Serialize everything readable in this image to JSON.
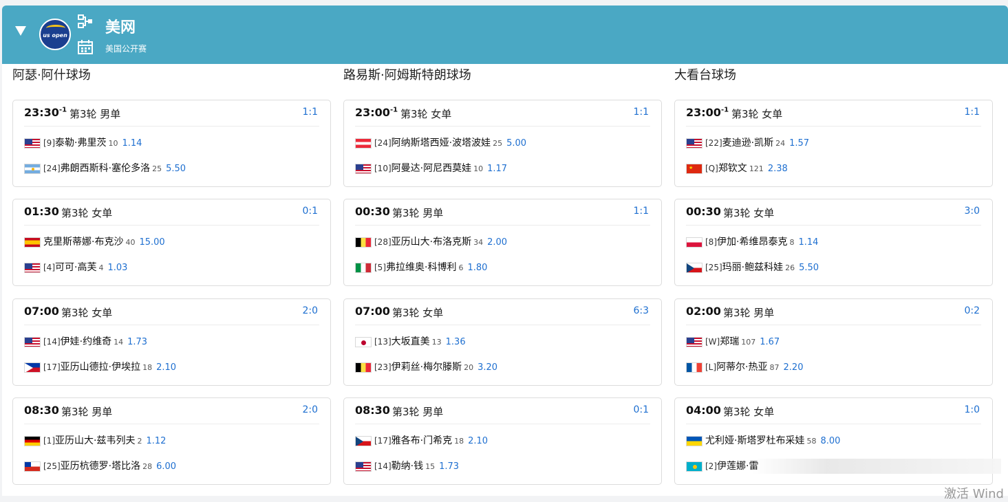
{
  "header": {
    "title": "美网",
    "subtitle": "美国公开赛",
    "logo_text": "us open"
  },
  "courts": [
    {
      "name": "阿瑟·阿什球场",
      "matches": [
        {
          "time": "23:30",
          "time_sup": "-1",
          "round": "第3轮 男单",
          "score": "1:1",
          "p1": {
            "flag": "us",
            "seed": "[9]",
            "name": "泰勒·弗里茨",
            "rank": "10",
            "odds": "1.14"
          },
          "p2": {
            "flag": "ar",
            "seed": "[24]",
            "name": "弗朗西斯科·塞伦多洛",
            "rank": "25",
            "odds": "5.50"
          }
        },
        {
          "time": "01:30",
          "time_sup": "",
          "round": "第3轮 女单",
          "score": "0:1",
          "p1": {
            "flag": "es",
            "seed": "",
            "name": "克里斯蒂娜·布克沙",
            "rank": "40",
            "odds": "15.00"
          },
          "p2": {
            "flag": "us",
            "seed": "[4]",
            "name": "可可·高芙",
            "rank": "4",
            "odds": "1.03"
          }
        },
        {
          "time": "07:00",
          "time_sup": "",
          "round": "第3轮 女单",
          "score": "2:0",
          "p1": {
            "flag": "us",
            "seed": "[14]",
            "name": "伊娃·约维奇",
            "rank": "14",
            "odds": "1.73"
          },
          "p2": {
            "flag": "ph",
            "seed": "[17]",
            "name": "亚历山德拉·伊埃拉",
            "rank": "18",
            "odds": "2.10"
          }
        },
        {
          "time": "08:30",
          "time_sup": "",
          "round": "第3轮 男单",
          "score": "2:0",
          "p1": {
            "flag": "de",
            "seed": "[1]",
            "name": "亚历山大·兹韦列夫",
            "rank": "2",
            "odds": "1.12"
          },
          "p2": {
            "flag": "cl",
            "seed": "[25]",
            "name": "亚历杭德罗·塔比洛",
            "rank": "28",
            "odds": "6.00"
          }
        }
      ]
    },
    {
      "name": "路易斯·阿姆斯特朗球场",
      "matches": [
        {
          "time": "23:00",
          "time_sup": "-1",
          "round": "第3轮 女单",
          "score": "1:1",
          "p1": {
            "flag": "at",
            "seed": "[24]",
            "name": "阿纳斯塔西娅·波塔波娃",
            "rank": "25",
            "odds": "5.00"
          },
          "p2": {
            "flag": "us",
            "seed": "[10]",
            "name": "阿曼达·阿尼西莫娃",
            "rank": "10",
            "odds": "1.17"
          }
        },
        {
          "time": "00:30",
          "time_sup": "",
          "round": "第3轮 男单",
          "score": "1:1",
          "p1": {
            "flag": "be",
            "seed": "[28]",
            "name": "亚历山大·布洛克斯",
            "rank": "34",
            "odds": "2.00"
          },
          "p2": {
            "flag": "it",
            "seed": "[5]",
            "name": "弗拉维奥·科博利",
            "rank": "6",
            "odds": "1.80"
          }
        },
        {
          "time": "07:00",
          "time_sup": "",
          "round": "第3轮 女单",
          "score": "6:3",
          "p1": {
            "flag": "jp",
            "seed": "[13]",
            "name": "大坂直美",
            "rank": "13",
            "odds": "1.36"
          },
          "p2": {
            "flag": "be",
            "seed": "[23]",
            "name": "伊莉丝·梅尔滕斯",
            "rank": "20",
            "odds": "3.20"
          }
        },
        {
          "time": "08:30",
          "time_sup": "",
          "round": "第3轮 男单",
          "score": "0:1",
          "p1": {
            "flag": "cz",
            "seed": "[17]",
            "name": "雅各布·门希克",
            "rank": "18",
            "odds": "2.10"
          },
          "p2": {
            "flag": "us",
            "seed": "[14]",
            "name": "勒纳·钱",
            "rank": "15",
            "odds": "1.73"
          }
        }
      ]
    },
    {
      "name": "大看台球场",
      "matches": [
        {
          "time": "23:00",
          "time_sup": "-1",
          "round": "第3轮 女单",
          "score": "1:1",
          "p1": {
            "flag": "us",
            "seed": "[22]",
            "name": "麦迪逊·凯斯",
            "rank": "24",
            "odds": "1.57"
          },
          "p2": {
            "flag": "cn",
            "seed": "[Q]",
            "name": "郑钦文",
            "rank": "121",
            "odds": "2.38"
          }
        },
        {
          "time": "00:30",
          "time_sup": "",
          "round": "第3轮 女单",
          "score": "3:0",
          "p1": {
            "flag": "pl",
            "seed": "[8]",
            "name": "伊加·希维昂泰克",
            "rank": "8",
            "odds": "1.14"
          },
          "p2": {
            "flag": "cz",
            "seed": "[25]",
            "name": "玛丽·鲍兹科娃",
            "rank": "26",
            "odds": "5.50"
          }
        },
        {
          "time": "02:00",
          "time_sup": "",
          "round": "第3轮 男单",
          "score": "0:2",
          "p1": {
            "flag": "us",
            "seed": "[W]",
            "name": "郑瑞",
            "rank": "107",
            "odds": "1.67"
          },
          "p2": {
            "flag": "fr",
            "seed": "[L]",
            "name": "阿蒂尔·热亚",
            "rank": "87",
            "odds": "2.20"
          }
        },
        {
          "time": "04:00",
          "time_sup": "",
          "round": "第3轮 女单",
          "score": "1:0",
          "p1": {
            "flag": "ua",
            "seed": "",
            "name": "尤利娅·斯塔罗杜布采娃",
            "rank": "58",
            "odds": "8.00"
          },
          "p2": {
            "flag": "kz",
            "seed": "[2]",
            "name": "伊莲娜·雷",
            "rank": "",
            "odds": ""
          }
        }
      ]
    }
  ],
  "watermark": "激活 Wind"
}
